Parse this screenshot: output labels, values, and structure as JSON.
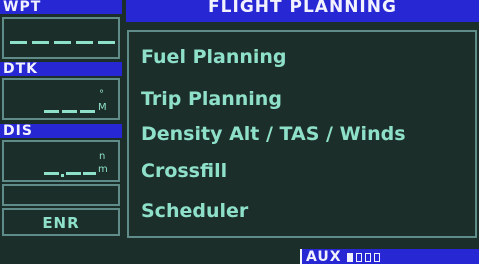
{
  "colors": {
    "background": "#1c2e2a",
    "header_blue": "#2727d4",
    "header_text": "#f2f2ff",
    "data_text": "#8ee0c8",
    "border": "#5f8b88"
  },
  "sidebar": {
    "fields": [
      {
        "label": "WPT",
        "value": "_____",
        "unit": ""
      },
      {
        "label": "DTK",
        "value": "___",
        "unit": "°M"
      },
      {
        "label": "DIS",
        "value": "__.__",
        "unit": "nm"
      }
    ],
    "mode": "ENR"
  },
  "page": {
    "title": "FLIGHT PLANNING",
    "menu_items": [
      "Fuel Planning",
      "Trip Planning",
      "Density Alt / TAS / Winds",
      "Crossfill",
      "Scheduler"
    ]
  },
  "status": {
    "page_group": "AUX",
    "page_count": 4,
    "active_page": 1
  }
}
